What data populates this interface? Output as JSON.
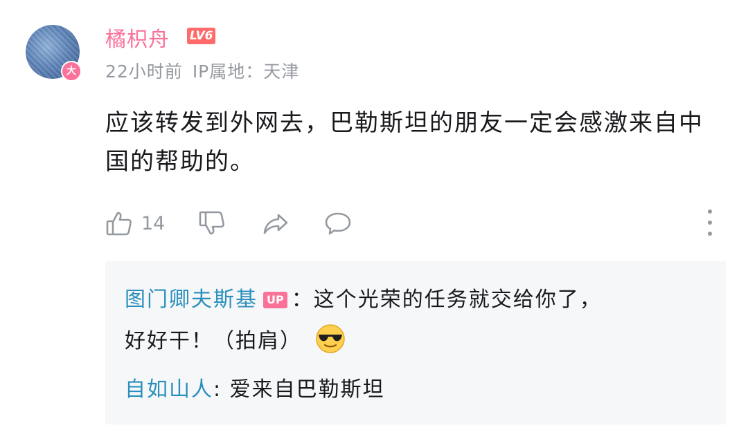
{
  "comment": {
    "username": "橘枳舟",
    "level": "LV6",
    "avatar_badge": "大",
    "time": "22小时前",
    "ip_location": "IP属地：天津",
    "text": "应该转发到外网去，巴勒斯坦的朋友一定会感激来自中国的帮助的。",
    "like_count": "14",
    "icons": {
      "like": "thumbs-up-icon",
      "dislike": "thumbs-down-icon",
      "share": "share-icon",
      "reply": "comment-bubble-icon",
      "more": "more-vertical-icon"
    }
  },
  "replies": [
    {
      "user": "图门卿夫斯基",
      "badge": "UP",
      "line1": "：这个光荣的任务就交给你了，",
      "line2": "好好干！（拍肩）",
      "emoji": "sunglasses-emoji-icon"
    },
    {
      "user": "自如山人",
      "text": ": 爱来自巴勒斯坦"
    }
  ],
  "colors": {
    "username_pink": "#fb7299",
    "reply_user_blue": "#2a8fbd",
    "meta_gray": "#9499a0",
    "level_red": "#ff6b6b",
    "reply_bg": "#f6f7f8"
  }
}
